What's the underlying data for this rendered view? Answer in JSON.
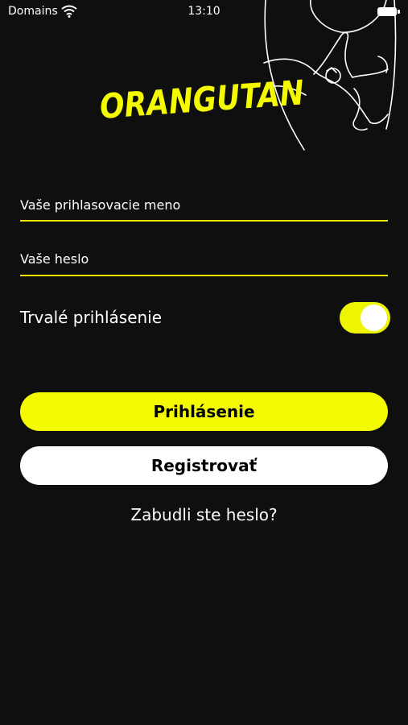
{
  "status": {
    "carrier": "Domains",
    "time": "13:10"
  },
  "logo": {
    "text": "ORANGUTAN"
  },
  "form": {
    "username_placeholder": "Vaše prihlasovacie meno",
    "password_placeholder": "Vaše heslo",
    "remember_label": "Trvalé prihlásenie",
    "remember_on": true
  },
  "buttons": {
    "login": "Prihlásenie",
    "register": "Registrovať"
  },
  "forgot_link": "Zabudli ste heslo?",
  "colors": {
    "accent": "#f4fb00",
    "background": "#0e0f0e"
  },
  "icons": {
    "wifi": "wifi-icon",
    "battery": "battery-icon",
    "mascot": "orangutan-illustration"
  }
}
